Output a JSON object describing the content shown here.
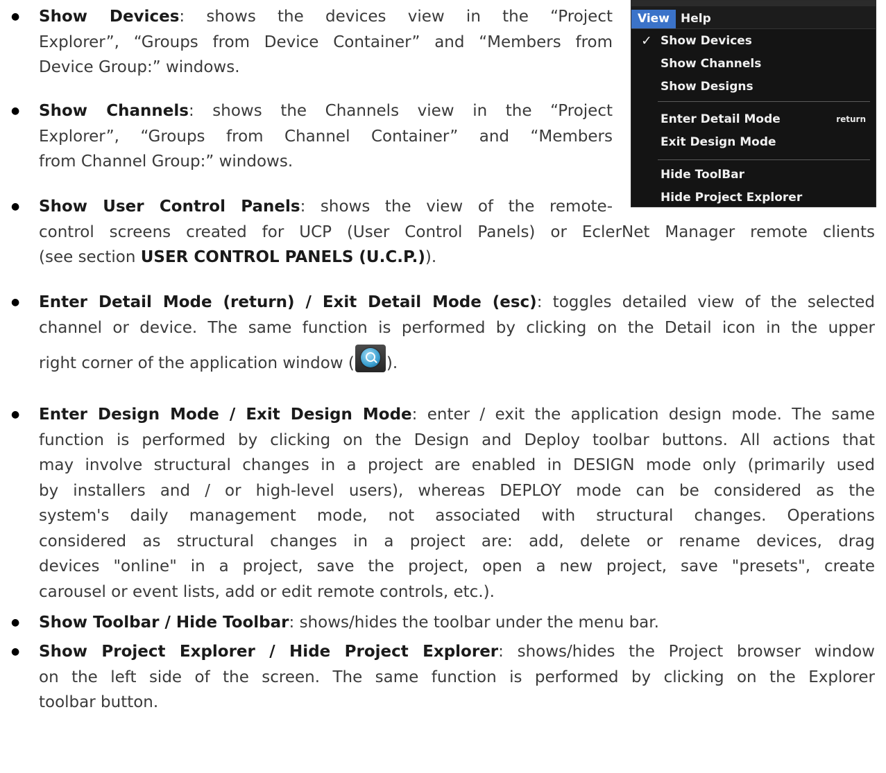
{
  "menu": {
    "titles": {
      "view": "View",
      "help": "Help"
    },
    "items": [
      {
        "label": "Show Devices",
        "check": "✓"
      },
      {
        "label": "Show Channels"
      },
      {
        "label": "Show Designs"
      },
      {
        "label": "Enter Detail Mode",
        "shortcut": "return"
      },
      {
        "label": "Exit Design Mode"
      },
      {
        "label": "Hide ToolBar"
      },
      {
        "label": "Hide Project Explorer"
      }
    ],
    "colors": {
      "background": "#141414",
      "highlight": "#3b73c9"
    }
  },
  "items": [
    {
      "term": "Show Devices",
      "l1": ": shows the devices view in the “Project",
      "l2": "Explorer”, “Groups from Device Container” and “Members from",
      "l3": "Device Group:” windows."
    },
    {
      "term": "Show Channels",
      "l1": ": shows the Channels view in the “Project",
      "l2": "Explorer”, “Groups from Channel Container” and “Members",
      "l3": "from Channel Group:” windows."
    },
    {
      "term": "Show User Control Panels",
      "l1": ": shows the view of the remote-",
      "l2": "control screens created for UCP (User Control Panels) or EclerNet Manager remote clients",
      "l3_pre": "(see section ",
      "l3_ref": "USER CONTROL PANELS (U.C.P.)",
      "l3_post": ")."
    },
    {
      "term": "Enter Detail Mode (return) / Exit Detail Mode (esc)",
      "l1": ": toggles detailed view of the selected",
      "l2": "channel or device. The same function is performed by clicking on the Detail icon in the upper",
      "l3_pre": "right corner of the application window (",
      "l3_post": ")."
    },
    {
      "term": "Enter Design Mode / Exit Design Mode",
      "l1": ": enter / exit the application design mode. The same",
      "l2": "function is performed by clicking on the Design and Deploy toolbar buttons. All actions that",
      "l3": "may involve structural changes in a project are enabled in DESIGN mode only (primarily used",
      "l4": "by installers and / or high-level users), whereas DEPLOY mode can be considered as the",
      "l5": "system's daily management mode, not associated with structural changes. Operations",
      "l6": "considered as structural changes in a project are: add, delete or rename devices, drag",
      "l7": "devices \"online\" in a project, save the project, open a new project, save \"presets\", create",
      "l8": "carousel or event lists, add or edit remote controls, etc.)."
    },
    {
      "term": "Show Toolbar / Hide Toolbar",
      "l1": ": shows/hides the toolbar under the menu bar."
    },
    {
      "term": "Show Project Explorer / Hide Project Explorer",
      "l1": ": shows/hides the Project browser window",
      "l2": "on the left side of the screen. The same function is performed by clicking on the Explorer",
      "l3": "toolbar button."
    }
  ]
}
